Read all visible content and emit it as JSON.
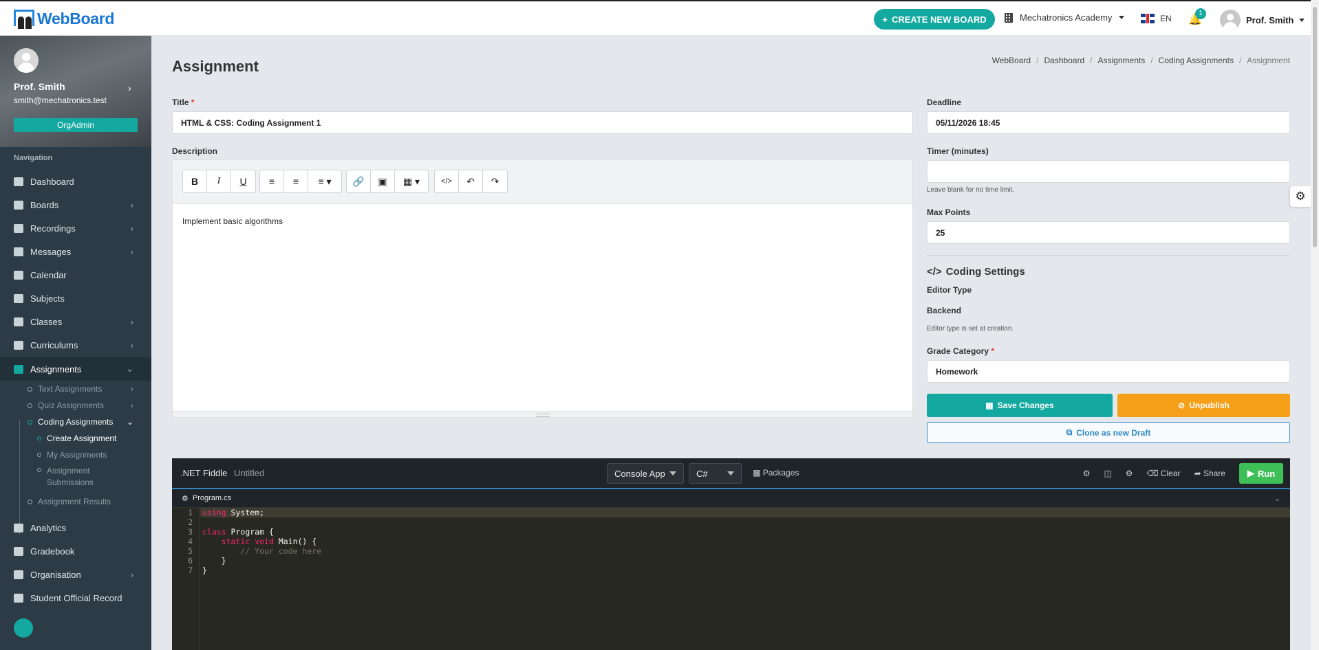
{
  "app": {
    "name": "WebBoard"
  },
  "topbar": {
    "create_label": "CREATE NEW BOARD",
    "org_name": "Mechatronics Academy",
    "lang": "EN",
    "notif_count": "1",
    "user_name": "Prof. Smith"
  },
  "sidebar": {
    "user_name": "Prof. Smith",
    "email": "smith@mechatronics.test",
    "role": "OrgAdmin",
    "nav_title": "Navigation",
    "items": [
      {
        "label": "Dashboard"
      },
      {
        "label": "Boards"
      },
      {
        "label": "Recordings"
      },
      {
        "label": "Messages"
      },
      {
        "label": "Calendar"
      },
      {
        "label": "Subjects"
      },
      {
        "label": "Classes"
      },
      {
        "label": "Curriculums"
      },
      {
        "label": "Assignments"
      },
      {
        "label": "Analytics"
      },
      {
        "label": "Gradebook"
      },
      {
        "label": "Organisation"
      },
      {
        "label": "Student Official Record"
      }
    ],
    "sub": {
      "text": "Text Assignments",
      "quiz": "Quiz Assignments",
      "coding": "Coding Assignments",
      "create": "Create Assignment",
      "mine": "My Assignments",
      "submissions": "Assignment Submissions",
      "results": "Assignment Results"
    }
  },
  "page": {
    "title": "Assignment",
    "breadcrumb": [
      "WebBoard",
      "Dashboard",
      "Assignments",
      "Coding Assignments",
      "Assignment"
    ]
  },
  "form": {
    "title_label": "Title",
    "title_value": "HTML & CSS: Coding Assignment 1",
    "desc_label": "Description",
    "desc_text": "Implement basic algorithms",
    "deadline_label": "Deadline",
    "deadline_value": "05/11/2026 18:45",
    "timer_label": "Timer (minutes)",
    "timer_value": "",
    "timer_help": "Leave blank for no time limit.",
    "maxpoints_label": "Max Points",
    "maxpoints_value": "25",
    "coding_title": "Coding Settings",
    "editor_type_label": "Editor Type",
    "editor_type_value": "Backend",
    "editor_type_help": "Editor type is set at creation.",
    "grade_label": "Grade Category",
    "grade_value": "Homework",
    "save_label": "Save Changes",
    "unpublish_label": "Unpublish",
    "clone_label": "Clone as new Draft"
  },
  "fiddle": {
    "brand": ".NET Fiddle",
    "untitled": "Untitled",
    "project_type": "Console App",
    "language": "C#",
    "packages": "Packages",
    "clear": "Clear",
    "share": "Share",
    "run": "Run",
    "file_name": "Program.cs",
    "line_numbers": [
      "1",
      "2",
      "3",
      "4",
      "5",
      "6",
      "7"
    ]
  }
}
